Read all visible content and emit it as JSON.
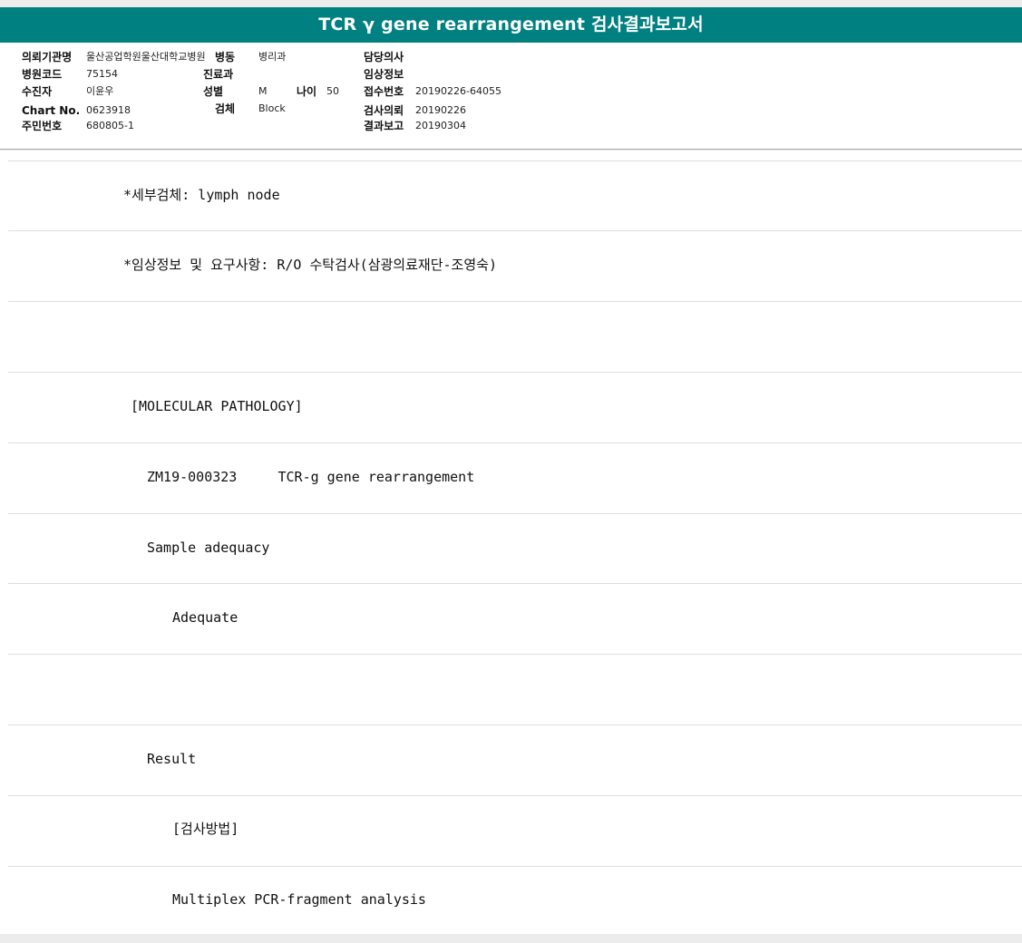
{
  "report": {
    "title": "TCR γ gene rearrangement 검사결과보고서",
    "theme_color": "#008080"
  },
  "header": {
    "institution_label": "의뢰기관명",
    "institution_value": "울산공업학원울산대학교병원",
    "ward_label": "병동",
    "ward_value": "병리과",
    "physician_label": "담당의사",
    "physician_value": "",
    "hospital_code_label": "병원코드",
    "hospital_code_value": "75154",
    "department_label": "진료과",
    "department_value": "",
    "clinical_info_label": "임상정보",
    "clinical_info_value": "",
    "patient_label": "수진자",
    "patient_value": "이윤우",
    "sex_label": "성별",
    "sex_value": "M",
    "age_label": "나이",
    "age_value": "50",
    "receipt_no_label": "접수번호",
    "receipt_no_value": "20190226-64055",
    "chart_no_label": "Chart No.",
    "chart_no_value": "0623918",
    "specimen_label": "검체",
    "specimen_value": "Block",
    "request_date_label": "검사의뢰",
    "request_date_value": "20190226",
    "resident_no_label": "주민번호",
    "resident_no_value": "680805-1",
    "report_date_label": "결과보고",
    "report_date_value": "20190304"
  },
  "body": {
    "lines": [
      "*세부검체: lymph node",
      "*임상정보 및 요구사항: R/O 수탁검사(삼광의료재단-조영숙)",
      "",
      "[MOLECULAR PATHOLOGY]",
      "ZM19-000323     TCR-g gene rearrangement",
      "Sample adequacy",
      "Adequate",
      "",
      "Result",
      "[검사방법]",
      "Multiplex PCR-fragment analysis"
    ]
  }
}
